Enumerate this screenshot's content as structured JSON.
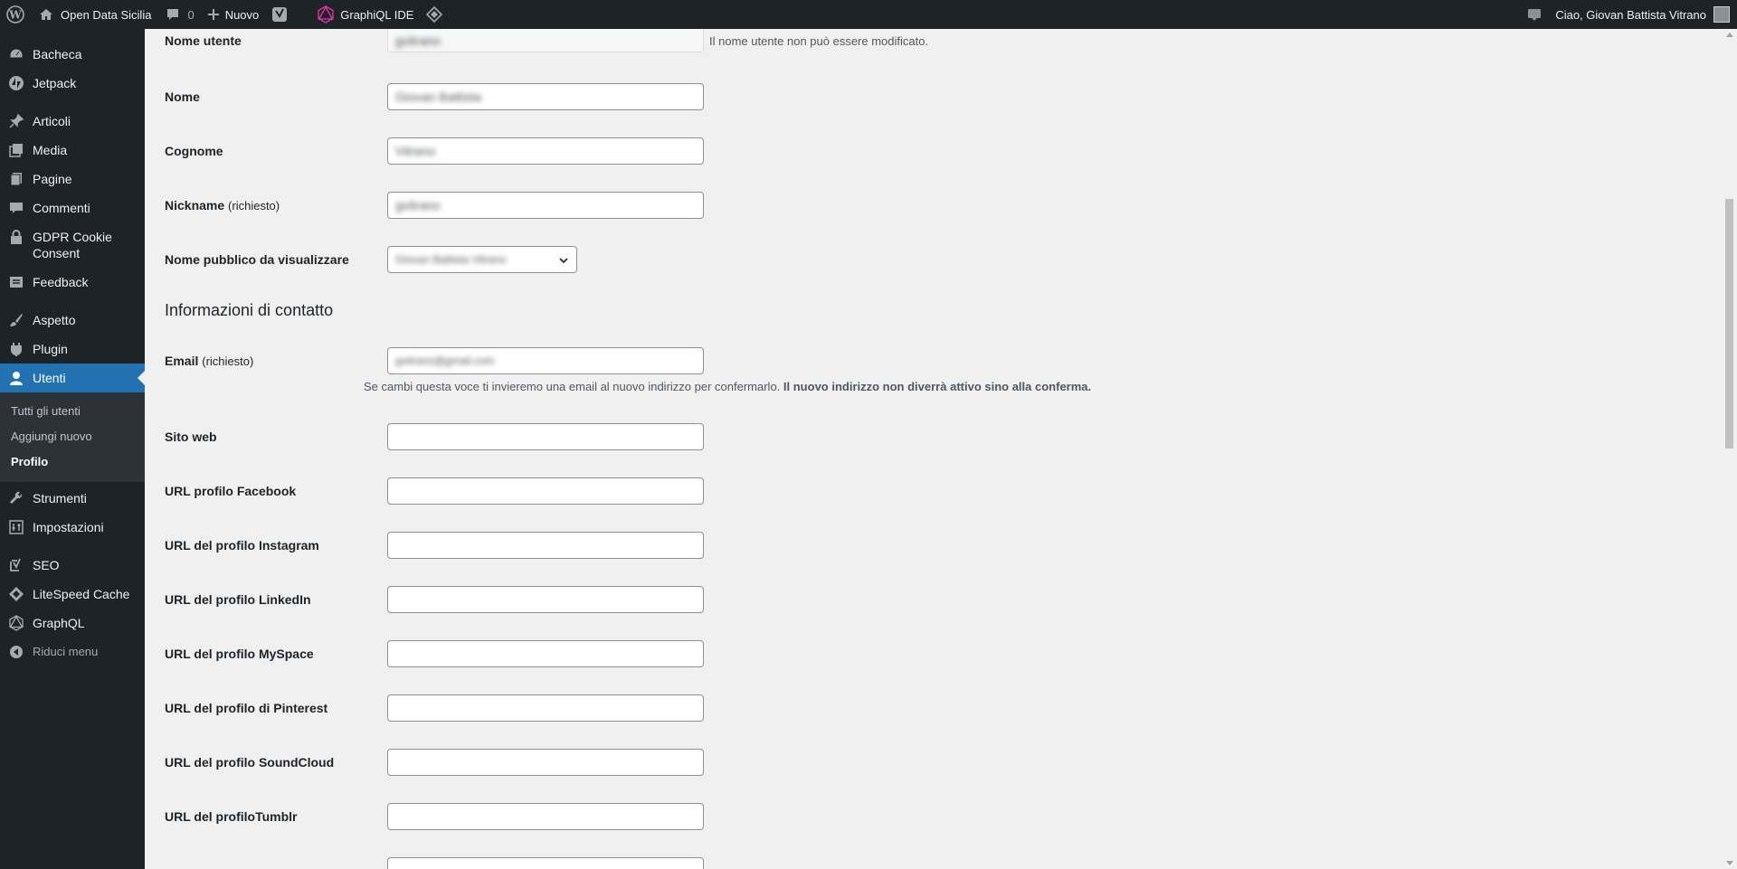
{
  "colors": {
    "adminbar_bg": "#1d2327",
    "sidebar_bg": "#1d2327",
    "accent": "#2271b1",
    "submenu_bg": "#2c3338",
    "page_bg": "#f0f0f1"
  },
  "adminbar": {
    "wp_logo_icon": "wordpress-icon",
    "site_name": "Open Data Sicilia",
    "comments_count": "0",
    "new_label": "Nuovo",
    "graphql_ide_label": "GraphiQL IDE",
    "greeting": "Ciao, Giovan Battista Vitrano"
  },
  "sidebar": {
    "items": [
      {
        "label": "Bacheca",
        "icon": "dashboard-icon"
      },
      {
        "label": "Jetpack",
        "icon": "jetpack-icon"
      },
      {
        "label": "Articoli",
        "icon": "pin-icon"
      },
      {
        "label": "Media",
        "icon": "media-icon"
      },
      {
        "label": "Pagine",
        "icon": "pages-icon"
      },
      {
        "label": "Commenti",
        "icon": "comments-icon"
      },
      {
        "label": "GDPR Cookie Consent",
        "icon": "lock-icon"
      },
      {
        "label": "Feedback",
        "icon": "feedback-icon"
      },
      {
        "label": "Aspetto",
        "icon": "brush-icon"
      },
      {
        "label": "Plugin",
        "icon": "plugin-icon"
      },
      {
        "label": "Utenti",
        "icon": "users-icon"
      },
      {
        "label": "Strumenti",
        "icon": "wrench-icon"
      },
      {
        "label": "Impostazioni",
        "icon": "settings-icon"
      },
      {
        "label": "SEO",
        "icon": "yoast-icon"
      },
      {
        "label": "LiteSpeed Cache",
        "icon": "litespeed-icon"
      },
      {
        "label": "GraphQL",
        "icon": "graphql-icon"
      },
      {
        "label": "Riduci menu",
        "icon": "collapse-icon"
      }
    ],
    "submenu": [
      {
        "label": "Tutti gli utenti"
      },
      {
        "label": "Aggiungi nuovo"
      },
      {
        "label": "Profilo"
      }
    ]
  },
  "form": {
    "username": {
      "label": "Nome utente",
      "value": "gvitrano",
      "description": "Il nome utente non può essere modificato."
    },
    "first_name": {
      "label": "Nome",
      "value": "Giovan Battista"
    },
    "last_name": {
      "label": "Cognome",
      "value": "Vitrano"
    },
    "nickname": {
      "label": "Nickname",
      "required": "(richiesto)",
      "value": "gvitrano"
    },
    "display_name": {
      "label": "Nome pubblico da visualizzare",
      "value": "Giovan Battista Vitrano"
    },
    "contact_section_title": "Informazioni di contatto",
    "email": {
      "label": "Email",
      "required": "(richiesto)",
      "value": "gvitrano@gmail.com",
      "description": "Se cambi questa voce ti invieremo una email al nuovo indirizzo per confermarlo.",
      "description_bold": "Il nuovo indirizzo non diverrà attivo sino alla conferma."
    },
    "website": {
      "label": "Sito web",
      "value": ""
    },
    "facebook": {
      "label": "URL profilo Facebook",
      "value": ""
    },
    "instagram": {
      "label": "URL del profilo Instagram",
      "value": ""
    },
    "linkedin": {
      "label": "URL del profilo LinkedIn",
      "value": ""
    },
    "myspace": {
      "label": "URL del profilo MySpace",
      "value": ""
    },
    "pinterest": {
      "label": "URL del profilo di Pinterest",
      "value": ""
    },
    "soundcloud": {
      "label": "URL del profilo SoundCloud",
      "value": ""
    },
    "tumblr": {
      "label": "URL del profiloTumblr",
      "value": ""
    }
  }
}
